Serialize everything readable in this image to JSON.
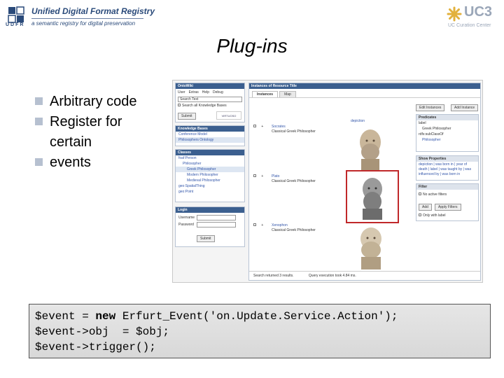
{
  "header": {
    "registry_title": "Unified Digital Format Registry",
    "registry_subtitle": "a semantic registry for digital preservation",
    "udfr_logo_text": "UDFR",
    "uc3_logo_text": "UC3",
    "uc3_logo_subtitle": "UC Curation Center"
  },
  "slide": {
    "title": "Plug-ins",
    "bullets": [
      "Arbitrary code",
      "Register for",
      "events"
    ],
    "bullet_continuation": "certain"
  },
  "screenshot": {
    "ontowiki_header": "OntoWiki",
    "menu": [
      "User",
      "Extras",
      "Help",
      "Debug"
    ],
    "search_placeholder": "Search Text",
    "search_checkbox_label": "Search all Knowledge Bases",
    "submit_label": "Submit",
    "knowledge_bases_header": "Knowledge Bases",
    "knowledge_bases": [
      "Conference Model",
      "Philosophers Ontology"
    ],
    "classes_header": "Classes",
    "classes": [
      "foaf:Person",
      "Philosopher",
      "Greek Philosopher",
      "Modern Philosopher",
      "Medieval Philosopher",
      "geo:SpatialThing",
      "geo:Point"
    ],
    "login_header": "Login",
    "username_label": "Username",
    "password_label": "Password",
    "login_submit": "Submit",
    "instances_header": "Instances of Resource Title",
    "tabs": [
      "Instances",
      "Map"
    ],
    "depiction_column": "depiction",
    "instances": [
      {
        "name": "Socrates",
        "type": "Classical Greek Philosopher"
      },
      {
        "name": "Plato",
        "type": "Classical Greek Philosopher"
      },
      {
        "name": "Xenophon",
        "type": "Classical Greek Philosopher"
      }
    ],
    "edit_instances": "Edit Instances",
    "add_instance": "Add Instance",
    "predicates_header": "Predicates",
    "predicates": [
      "label",
      "Greek Philosopher",
      "rdfs:subClassOf",
      "Philosopher"
    ],
    "show_properties_header": "Show Properties",
    "properties": [
      "depiction",
      "was born in",
      "year of death",
      "label",
      "was taught by",
      "was influenced by",
      "was born in"
    ],
    "filter_header": "Filter",
    "filter_checkbox": "No active filters",
    "filter_add": "Add",
    "filter_apply": "Apply Filters",
    "filter_only_label": "Only with label",
    "status_left": "Search returned 3 results.",
    "status_right": "Query execution took 4.84 ms."
  },
  "code": {
    "line1_pre": "$event = ",
    "line1_kw": "new",
    "line1_post": " Erfurt_Event('on.Update.Service.Action');",
    "line2": "$event->obj  = $obj;",
    "line3": "$event->trigger();"
  },
  "colors": {
    "header_blue": "#2a4a7a",
    "uc3_gray": "#9aa6b8",
    "bullet_square": "#b6c0d0",
    "panel_header": "#3b5f8f",
    "highlight_red": "#c0282a"
  }
}
